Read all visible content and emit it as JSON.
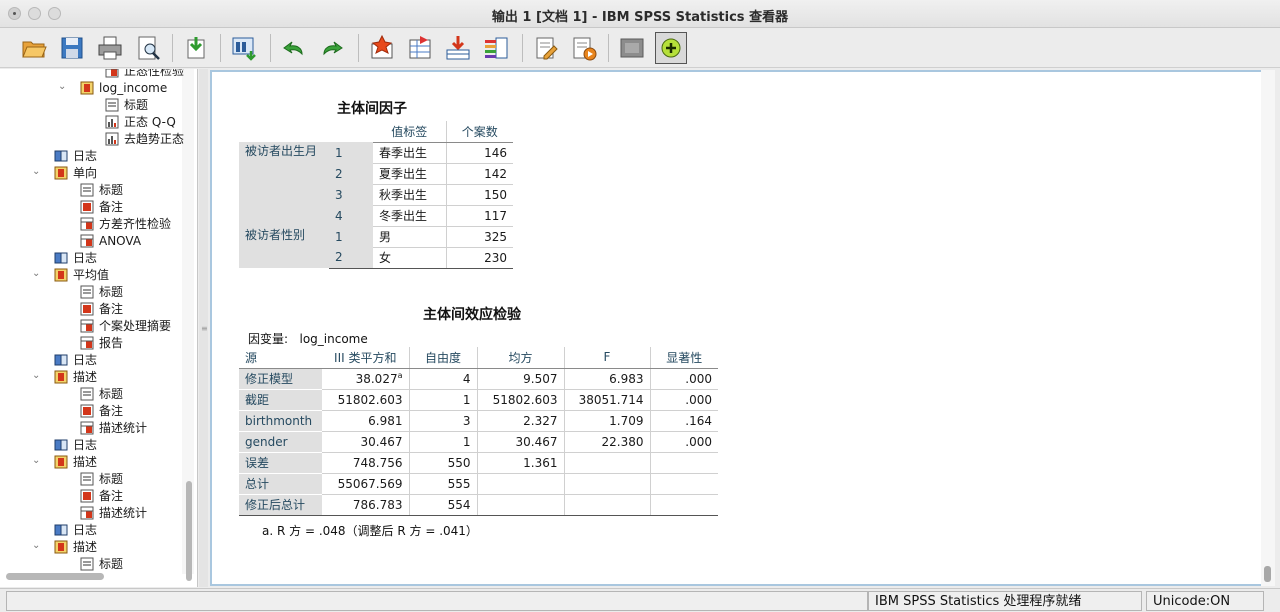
{
  "window": {
    "title": "输出 1 [文档 1] - IBM SPSS Statistics 查看器"
  },
  "toolbar": {
    "buttons": [
      "open-icon",
      "save-icon",
      "print-icon",
      "print-preview-icon",
      "export-icon",
      "recall-dialog-icon",
      "undo-icon",
      "redo-icon",
      "goto-data-icon",
      "goto-case-icon",
      "insert-output-icon",
      "variables-icon",
      "designate-window-icon",
      "script-icon",
      "create-title-icon",
      "hide-icon",
      "show-icon"
    ]
  },
  "outline": {
    "items": [
      {
        "label": "正态性检验",
        "icon": "table-icon",
        "level": 3
      },
      {
        "label": "log_income",
        "icon": "folder-book-icon",
        "level": 2
      },
      {
        "label": "标题",
        "icon": "title-icon",
        "level": 3
      },
      {
        "label": "正态 Q-Q",
        "icon": "chart-icon",
        "level": 3
      },
      {
        "label": "去趋势正态",
        "icon": "chart-icon",
        "level": 3
      },
      {
        "label": "日志",
        "icon": "log-icon",
        "level": 1
      },
      {
        "label": "单向",
        "icon": "folder-book-icon",
        "level": 1
      },
      {
        "label": "标题",
        "icon": "title-icon",
        "level": 2
      },
      {
        "label": "备注",
        "icon": "notes-icon",
        "level": 2
      },
      {
        "label": "方差齐性检验",
        "icon": "table-icon",
        "level": 2
      },
      {
        "label": "ANOVA",
        "icon": "table-icon",
        "level": 2
      },
      {
        "label": "日志",
        "icon": "log-icon",
        "level": 1
      },
      {
        "label": "平均值",
        "icon": "folder-book-icon",
        "level": 1
      },
      {
        "label": "标题",
        "icon": "title-icon",
        "level": 2
      },
      {
        "label": "备注",
        "icon": "notes-icon",
        "level": 2
      },
      {
        "label": "个案处理摘要",
        "icon": "table-icon",
        "level": 2
      },
      {
        "label": "报告",
        "icon": "table-icon",
        "level": 2
      },
      {
        "label": "日志",
        "icon": "log-icon",
        "level": 1
      },
      {
        "label": "描述",
        "icon": "folder-book-icon",
        "level": 1
      },
      {
        "label": "标题",
        "icon": "title-icon",
        "level": 2
      },
      {
        "label": "备注",
        "icon": "notes-icon",
        "level": 2
      },
      {
        "label": "描述统计",
        "icon": "table-icon",
        "level": 2
      },
      {
        "label": "日志",
        "icon": "log-icon",
        "level": 1
      },
      {
        "label": "描述",
        "icon": "folder-book-icon",
        "level": 1
      },
      {
        "label": "标题",
        "icon": "title-icon",
        "level": 2
      },
      {
        "label": "备注",
        "icon": "notes-icon",
        "level": 2
      },
      {
        "label": "描述统计",
        "icon": "table-icon",
        "level": 2
      },
      {
        "label": "日志",
        "icon": "log-icon",
        "level": 1
      },
      {
        "label": "描述",
        "icon": "folder-book-icon",
        "level": 1
      },
      {
        "label": "标题",
        "icon": "title-icon",
        "level": 2
      }
    ]
  },
  "factors": {
    "title": "主体间因子",
    "col_value_label": "值标签",
    "col_n": "个案数",
    "groups": [
      {
        "name": "被访者出生月",
        "rows": [
          {
            "code": "1",
            "label": "春季出生",
            "n": "146"
          },
          {
            "code": "2",
            "label": "夏季出生",
            "n": "142"
          },
          {
            "code": "3",
            "label": "秋季出生",
            "n": "150"
          },
          {
            "code": "4",
            "label": "冬季出生",
            "n": "117"
          }
        ]
      },
      {
        "name": "被访者性别",
        "rows": [
          {
            "code": "1",
            "label": "男",
            "n": "325"
          },
          {
            "code": "2",
            "label": "女",
            "n": "230"
          }
        ]
      }
    ]
  },
  "tests": {
    "title": "主体间效应检验",
    "dep_label": "因变量:",
    "dep_value": "log_income",
    "headers": [
      "源",
      "III 类平方和",
      "自由度",
      "均方",
      "F",
      "显著性"
    ],
    "rows": [
      {
        "source": "修正模型",
        "ss": "38.027",
        "sup": "a",
        "df": "4",
        "ms": "9.507",
        "f": "6.983",
        "sig": ".000"
      },
      {
        "source": "截距",
        "ss": "51802.603",
        "df": "1",
        "ms": "51802.603",
        "f": "38051.714",
        "sig": ".000"
      },
      {
        "source": "birthmonth",
        "ss": "6.981",
        "df": "3",
        "ms": "2.327",
        "f": "1.709",
        "sig": ".164"
      },
      {
        "source": "gender",
        "ss": "30.467",
        "df": "1",
        "ms": "30.467",
        "f": "22.380",
        "sig": ".000"
      },
      {
        "source": "误差",
        "ss": "748.756",
        "df": "550",
        "ms": "1.361",
        "f": "",
        "sig": ""
      },
      {
        "source": "总计",
        "ss": "55067.569",
        "df": "555",
        "ms": "",
        "f": "",
        "sig": ""
      },
      {
        "source": "修正后总计",
        "ss": "786.783",
        "df": "554",
        "ms": "",
        "f": "",
        "sig": ""
      }
    ],
    "footnote": "a. R 方 = .048（调整后 R 方 = .041）"
  },
  "status": {
    "processor": "IBM SPSS Statistics 处理程序就绪",
    "unicode": "Unicode:ON"
  }
}
